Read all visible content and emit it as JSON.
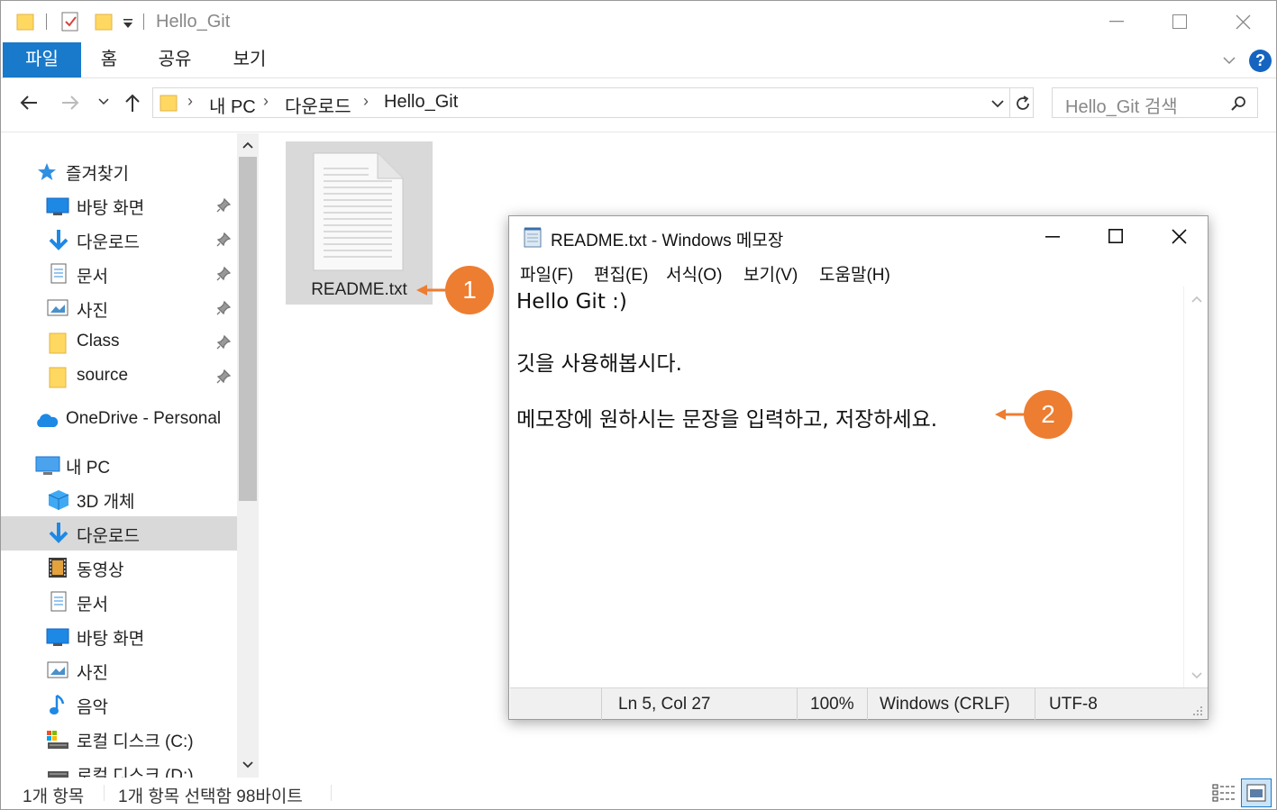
{
  "window": {
    "title": "Hello_Git"
  },
  "ribbon": {
    "tabs": [
      {
        "label": "파일",
        "active": true
      },
      {
        "label": "홈"
      },
      {
        "label": "공유"
      },
      {
        "label": "보기"
      }
    ],
    "help_glyph": "?"
  },
  "address": {
    "crumbs": [
      "내 PC",
      "다운로드",
      "Hello_Git"
    ],
    "search_placeholder": "Hello_Git 검색"
  },
  "sidebar": {
    "quick_access": {
      "label": "즐겨찾기",
      "icon": "star-icon"
    },
    "quick_items": [
      {
        "label": "바탕 화면",
        "icon": "desktop-icon",
        "pinned": true
      },
      {
        "label": "다운로드",
        "icon": "download-icon",
        "pinned": true
      },
      {
        "label": "문서",
        "icon": "document-icon",
        "pinned": true
      },
      {
        "label": "사진",
        "icon": "picture-icon",
        "pinned": true
      },
      {
        "label": "Class",
        "icon": "folder-icon",
        "pinned": true
      },
      {
        "label": "source",
        "icon": "folder-icon",
        "pinned": true
      }
    ],
    "onedrive": {
      "label": "OneDrive - Personal",
      "icon": "cloud-icon"
    },
    "this_pc": {
      "label": "내 PC",
      "icon": "computer-icon"
    },
    "pc_items": [
      {
        "label": "3D 개체",
        "icon": "cube-icon"
      },
      {
        "label": "다운로드",
        "icon": "download-icon",
        "selected": true
      },
      {
        "label": "동영상",
        "icon": "video-icon"
      },
      {
        "label": "문서",
        "icon": "document-icon"
      },
      {
        "label": "바탕 화면",
        "icon": "desktop-icon"
      },
      {
        "label": "사진",
        "icon": "picture-icon"
      },
      {
        "label": "음악",
        "icon": "music-icon"
      },
      {
        "label": "로컬 디스크 (C:)",
        "icon": "drive-icon"
      },
      {
        "label": "로컬 디스크 (D:)",
        "icon": "drive-icon"
      }
    ]
  },
  "files": [
    {
      "name": "README.txt",
      "icon": "text-file-icon",
      "selected": true
    }
  ],
  "status": {
    "count": "1개 항목",
    "selection": "1개 항목 선택함 98바이트"
  },
  "notepad": {
    "title": "README.txt - Windows 메모장",
    "menus": [
      "파일(F)",
      "편집(E)",
      "서식(O)",
      "보기(V)",
      "도움말(H)"
    ],
    "lines": [
      "Hello Git :)",
      "",
      "깃을 사용해봅시다.",
      "",
      "메모장에 원하시는 문장을 입력하고, 저장하세요."
    ],
    "status": {
      "position": "Ln 5, Col 27",
      "zoom": "100%",
      "line_ending": "Windows (CRLF)",
      "encoding": "UTF-8"
    }
  },
  "callouts": [
    "1",
    "2"
  ],
  "colors": {
    "accent": "#1979ca",
    "callout": "#ed7d31",
    "folder": "#ffd862"
  }
}
